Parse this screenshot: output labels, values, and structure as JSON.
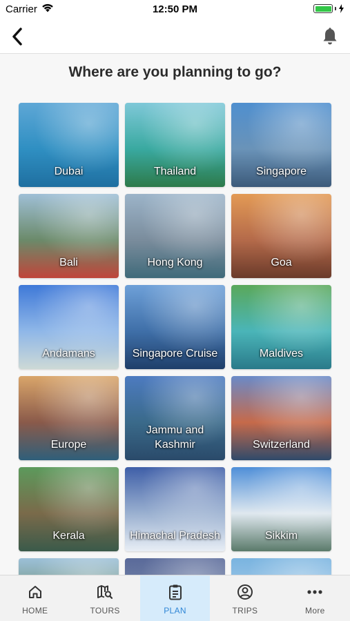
{
  "status_bar": {
    "carrier": "Carrier",
    "time": "12:50 PM"
  },
  "header": {
    "back_icon": "chevron-left-icon",
    "bell_icon": "bell-icon"
  },
  "page": {
    "title": "Where are you planning to go?"
  },
  "destinations": [
    {
      "name": "Dubai",
      "colors": [
        "#5ea7d6",
        "#2f8fc2",
        "#1f6fa0"
      ]
    },
    {
      "name": "Thailand",
      "colors": [
        "#7fc8d8",
        "#39a9a0",
        "#2d7a4a"
      ]
    },
    {
      "name": "Singapore",
      "colors": [
        "#4f8fcf",
        "#6a93b8",
        "#3c5a7a"
      ]
    },
    {
      "name": "Bali",
      "colors": [
        "#9fbfd6",
        "#6b8a6a",
        "#c0453a"
      ]
    },
    {
      "name": "Hong Kong",
      "colors": [
        "#9cb4c9",
        "#7a8c9c",
        "#3f6a7a"
      ]
    },
    {
      "name": "Goa",
      "colors": [
        "#e39a55",
        "#b46a4a",
        "#6a3a2a"
      ]
    },
    {
      "name": "Andamans",
      "colors": [
        "#3f79d8",
        "#8fb7e8",
        "#cdd9d6"
      ]
    },
    {
      "name": "Singapore Cruise",
      "colors": [
        "#6ea0d8",
        "#3f6fa8",
        "#1f3f6a"
      ]
    },
    {
      "name": "Maldives",
      "colors": [
        "#5aa85a",
        "#4ab5b8",
        "#2a7a8a"
      ]
    },
    {
      "name": "Europe",
      "colors": [
        "#d9a56a",
        "#8a5a4a",
        "#2f5f7a"
      ]
    },
    {
      "name": "Jammu and Kashmir",
      "colors": [
        "#4d7bc0",
        "#3a6a8a",
        "#2a4a6a"
      ]
    },
    {
      "name": "Switzerland",
      "colors": [
        "#6a8ac8",
        "#c66a4a",
        "#2f4a6a"
      ]
    },
    {
      "name": "Kerala",
      "colors": [
        "#5c9a5c",
        "#7a6a4a",
        "#3a5a4a"
      ]
    },
    {
      "name": "Himachal Pradesh",
      "colors": [
        "#3f5fa8",
        "#9ab0d0",
        "#e8eef5"
      ]
    },
    {
      "name": "Sikkim",
      "colors": [
        "#4f8fd8",
        "#dfe8ef",
        "#5a7a6a"
      ]
    },
    {
      "name": "",
      "colors": [
        "#9cc0d8",
        "#6a8a6a",
        "#4a6a5a"
      ]
    },
    {
      "name": "",
      "colors": [
        "#5a6a9a",
        "#7a8aaa",
        "#9aa6c0"
      ]
    },
    {
      "name": "",
      "colors": [
        "#7ab4e0",
        "#a8cce8",
        "#6a9ac0"
      ]
    }
  ],
  "tabs": [
    {
      "label": "HOME",
      "icon": "home-icon",
      "active": false
    },
    {
      "label": "TOURS",
      "icon": "map-search-icon",
      "active": false
    },
    {
      "label": "PLAN",
      "icon": "clipboard-icon",
      "active": true
    },
    {
      "label": "TRIPS",
      "icon": "account-circle-icon",
      "active": false
    },
    {
      "label": "More",
      "icon": "more-dots-icon",
      "active": false
    }
  ],
  "theme": {
    "accent": "#2f86d6",
    "active_tab_bg": "#d6ebfb",
    "tab_text": "#555555",
    "title_text": "#2b2b2b"
  }
}
